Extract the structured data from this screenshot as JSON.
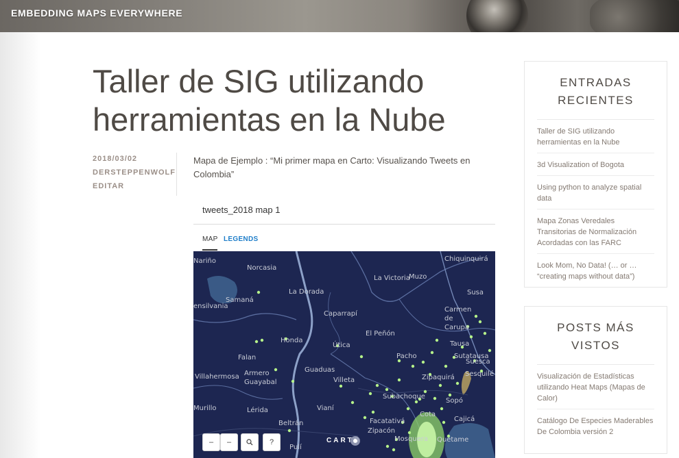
{
  "site": {
    "title": "EMBEDDING MAPS EVERYWHERE"
  },
  "post": {
    "title_line1": "Taller de SIG utilizando",
    "title_line2": "herramientas en la Nube",
    "date": "2018/03/02",
    "author": "DERSTEPPENWOLF",
    "edit_label": "EDITAR",
    "intro": "Mapa de Ejemplo : “Mi primer mapa en Carto: Visualizando Tweets en Colombia”"
  },
  "map_embed": {
    "title": "tweets_2018 map 1",
    "tabs": [
      "MAP",
      "LEGENDS"
    ],
    "active_tab": "MAP",
    "place_labels": [
      "Chiquinquirá",
      "Nariño",
      "Norcasia",
      "La Victoria",
      "Muzo",
      "Samaná",
      "La Dorada",
      "Susa",
      "ensilvania",
      "Caparrapí",
      "Carmen de Carupa",
      "El Peñón",
      "Tausa",
      "Honda",
      "Útica",
      "Pacho",
      "Falan",
      "Sutatausa",
      "Suesca",
      "Armero Guayabal",
      "Guaduas",
      "Zipaquirá",
      "Sesquilé",
      "Villahermosa",
      "Villeta",
      "Subachoque",
      "Sopó",
      "Murillo",
      "Lérida",
      "Vianí",
      "Facatativá",
      "Zipacón",
      "Beltrán",
      "Mosquera",
      "Cota",
      "Quetame",
      "Pulí",
      "Cajicá"
    ],
    "controls": [
      "–",
      "–",
      "search",
      "?"
    ],
    "attribution": "CARTO",
    "colors": {
      "map_bg": "#1d2651",
      "tweet_point": "#b5f28a",
      "water": "#3a5a86"
    }
  },
  "sidebar": {
    "recent": {
      "title_line1": "ENTRADAS",
      "title_line2": "RECIENTES",
      "items": [
        "Taller de SIG utilizando herramientas en la Nube",
        "3d Visualization of Bogota",
        "Using python to analyze spatial data",
        "Mapa Zonas Veredales Transitorias de Normalización Acordadas con las FARC",
        "Look Mom, No Data! (… or … “creating maps without data”)"
      ]
    },
    "popular": {
      "title_line1": "POSTS MÁS",
      "title_line2": "VISTOS",
      "items": [
        "Visualización de Estadísticas utilizando Heat Maps (Mapas de Calor)",
        "Catálogo De Especies Maderables De Colombia versión 2"
      ]
    }
  }
}
